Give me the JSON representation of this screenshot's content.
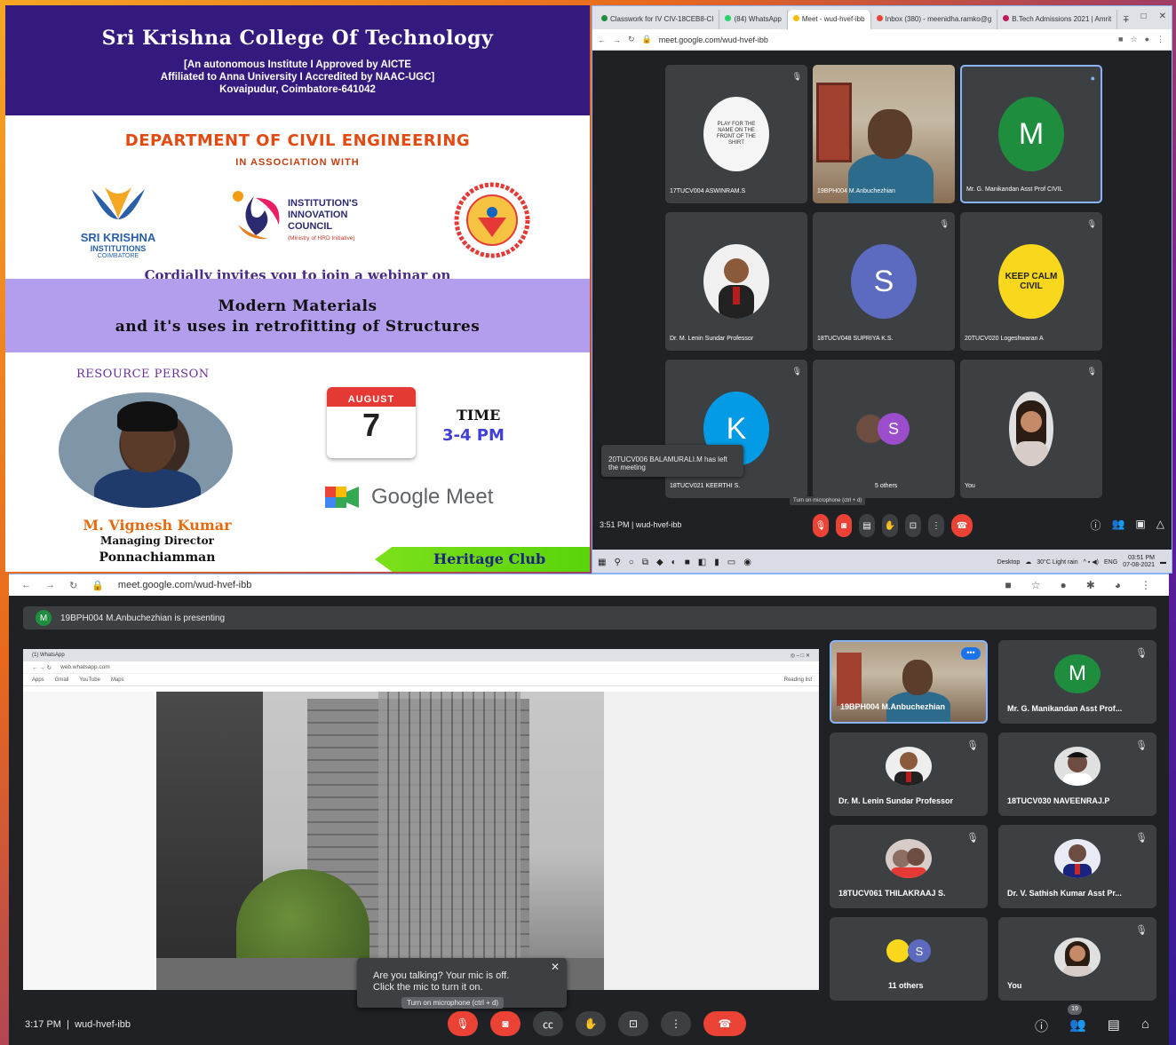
{
  "poster": {
    "college": "Sri Krishna College Of Technology",
    "sub1": "[An autonomous Institute I Approved by AICTE",
    "sub2": "Affiliated to Anna University I Accredited by NAAC-UGC]",
    "sub3": "Kovaipudur, Coimbatore-641042",
    "dept": "DEPARTMENT OF CIVIL ENGINEERING",
    "assoc": "IN ASSOCIATION WITH",
    "logo_sk_1": "SRI KRISHNA",
    "logo_sk_2": "INSTITUTIONS",
    "logo_sk_3": "COIMBATORE",
    "iic_1": "INSTITUTION'S",
    "iic_2": "INNOVATION",
    "iic_3": "COUNCIL",
    "iic_4": "(Ministry of HRD Initiative)",
    "invite": "Cordially invites you to join a webinar on",
    "title1": "Modern Materials",
    "title2": "and it's uses in retrofitting of Structures",
    "resource": "RESOURCE PERSON",
    "speaker": "M. Vignesh Kumar",
    "designation": "Managing Director",
    "company": "Ponnachiamman",
    "month": "AUGUST",
    "day": "7",
    "time_label": "TIME",
    "time_value": "3-4 PM",
    "gmeet": "Google Meet",
    "heritage": "Heritage Club"
  },
  "win1": {
    "tabs": [
      "Classwork for IV CIV-18CEB8-CI",
      "(84) WhatsApp",
      "Meet - wud-hvef-ibb",
      "Inbox (380) - meenidha.ramko@g",
      "B.Tech Admissions 2021 | Amrit"
    ],
    "url": "meet.google.com/wud-hvef-ibb",
    "tiles": [
      {
        "name": "17TUCV004 ASWINRAM.S",
        "kind": "badge"
      },
      {
        "name": "19BPH004 M.Anbuchezhian",
        "kind": "video"
      },
      {
        "name": "Mr. G. Manikandan Asst Prof CIVIL",
        "kind": "letter",
        "letter": "M",
        "color": "#1e8e3e"
      },
      {
        "name": "Dr. M. Lenin Sundar Professor",
        "kind": "photo"
      },
      {
        "name": "18TUCV048 SUPRIYA K.S.",
        "kind": "letter",
        "letter": "S",
        "color": "#5c6bc0"
      },
      {
        "name": "20TUCV020 Logeshwaran A",
        "kind": "keepcalm"
      },
      {
        "name": "18TUCV021 KEERTHI S.",
        "kind": "letter",
        "letter": "K",
        "color": "#039be5"
      },
      {
        "name": "5 others",
        "kind": "others"
      },
      {
        "name": "You",
        "kind": "photo-f"
      }
    ],
    "badge_text": "PLAY FOR THE NAME ON THE FRONT OF THE SHIRT",
    "keepcalm": "KEEP CALM CIVIL",
    "toast": "20TUCV006 BALAMURALI.M has left the meeting",
    "tooltip": "Turn on microphone (ctrl + d)",
    "time": "3:51 PM",
    "code": "wud-hvef-ibb",
    "taskbar_desktop": "Desktop",
    "weather": "30°C Light rain",
    "lang": "ENG",
    "clock_time": "03:51 PM",
    "clock_date": "07-08-2021"
  },
  "win2": {
    "url": "meet.google.com/wud-hvef-ibb",
    "presenter_initial": "M",
    "presenting": "19BPH004 M.Anbuchezhian is presenting",
    "share": {
      "tab": "(1) WhatsApp",
      "url": "web.whatsapp.com",
      "bookmarks": [
        "Apps",
        "Gmail",
        "YouTube",
        "Maps"
      ],
      "reading_list": "Reading list"
    },
    "participants": [
      {
        "name": "19BPH004 M.Anbuchezhian",
        "kind": "video"
      },
      {
        "name": "Mr. G. Manikandan Asst Prof...",
        "kind": "letter",
        "letter": "M",
        "color": "#1e8e3e"
      },
      {
        "name": "Dr. M. Lenin Sundar Professor",
        "kind": "photo"
      },
      {
        "name": "18TUCV030 NAVEENRAJ.P",
        "kind": "photo"
      },
      {
        "name": "18TUCV061 THILAKRAAJ S.",
        "kind": "photo"
      },
      {
        "name": "Dr. V. Sathish Kumar Asst Pr...",
        "kind": "photo"
      },
      {
        "name": "11 others",
        "kind": "others"
      },
      {
        "name": "You",
        "kind": "photo-f"
      }
    ],
    "toast_line1": "Are you talking? Your mic is off.",
    "toast_line2": "Click the mic to turn it on.",
    "tooltip": "Turn on microphone (ctrl + d)",
    "time": "3:17 PM",
    "code": "wud-hvef-ibb",
    "people_count": "19"
  },
  "colors": {
    "poster_header": "#341a7e",
    "accent_orange": "#e34a12",
    "banner": "#b39ded",
    "meet_bg": "#202124",
    "tile_bg": "#3c4043",
    "end_call": "#ea4335"
  }
}
